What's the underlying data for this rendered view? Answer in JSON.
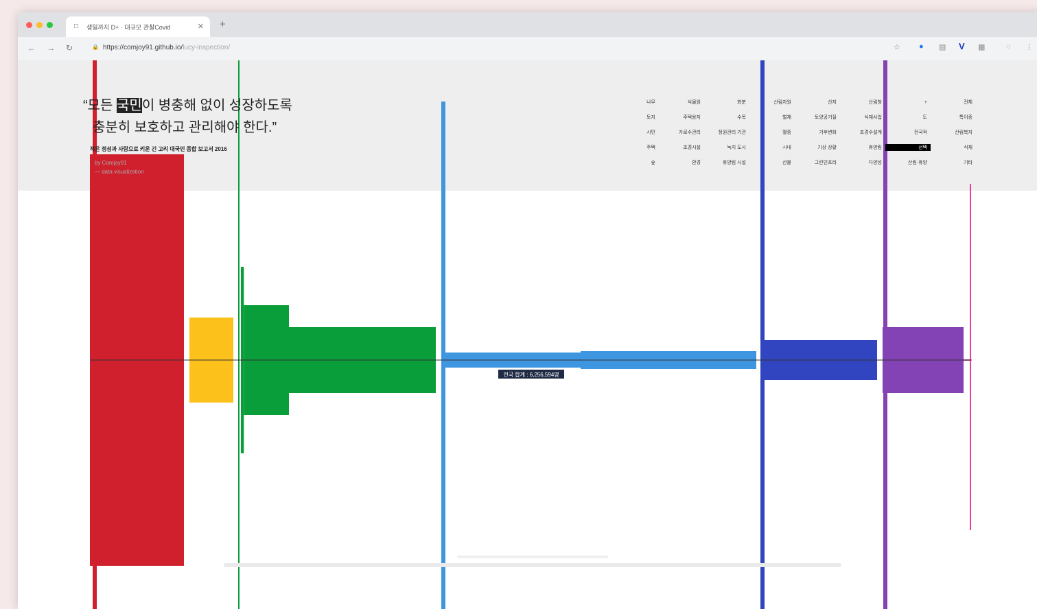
{
  "browser": {
    "tab_favicon": "□",
    "tab_title": "생일까지 D+ · 대규모 관찰Covid",
    "tab_close": "✕",
    "new_tab": "+",
    "back": "←",
    "forward": "→",
    "reload": "↻",
    "lock": "🔒",
    "url": "https://comjoy91.github.io/",
    "url_path": "lucy-inspection/",
    "ext_star": "☆",
    "ext_1": "●",
    "ext_2": "▤",
    "ext_3": "V",
    "ext_4": "▦",
    "ext_5": "◌",
    "ext_6": "⋮"
  },
  "quote": {
    "open_mark": "“",
    "line1_a": "모든 ",
    "line1_hl": "국민",
    "line1_b": "이 병충해 없이 성장하도록",
    "line2": "충분히 보호하고 관리해야 한다.",
    "close_mark": "”",
    "cite": "작은 정성과 사랑으로 키운 긴 고리 대국민 종합 보고서 2016",
    "sub1": "by Comjoy91",
    "sub2": "— data visualization"
  },
  "nav_grid": [
    [
      "나무",
      "식물원",
      "화분",
      "산림자원",
      "산지",
      "산림청",
      "+",
      "전체"
    ],
    [
      "토지",
      "주택용지",
      "수목",
      "벌채",
      "토양공기질",
      "식재사업",
      "도",
      "특이종"
    ],
    [
      "시민",
      "가로수관리",
      "정원관리 기관",
      "멸종",
      "기후변화",
      "조경수설계",
      "전국적",
      "산림복지"
    ],
    [
      "주택",
      "조경시설",
      "녹지 도시",
      "시내",
      "기상 상황",
      "휴양림",
      "선택",
      "식재"
    ],
    [
      "숲",
      "환경",
      "휴양림 시설",
      "산불",
      "그린인프라",
      "다양성",
      "산림·휴양",
      "기타"
    ]
  ],
  "nav_active": {
    "row": 3,
    "col": 6
  },
  "chart_data": {
    "type": "bar",
    "orientation": "horizontal-stream",
    "annotation": "전국 합계 : 6,256,594명",
    "colors": [
      "#d0202e",
      "#fcc21b",
      "#0a9e3a",
      "#3f96e0",
      "#3145c1",
      "#8443b5",
      "#e83d9f"
    ],
    "series": [
      {
        "color": "#d0202e",
        "segments": [
          {
            "x0": 0,
            "x1": 1,
            "half": 15
          }
        ]
      },
      {
        "color": "#fcc21b",
        "segments": [
          {
            "x0": 1,
            "x1": 2,
            "half": 3.1
          }
        ]
      },
      {
        "color": "#0a9e3a",
        "segments": [
          {
            "x0": 2,
            "x1": 2.1,
            "half": 6.8
          },
          {
            "x0": 2.1,
            "x1": 3,
            "half": 4
          },
          {
            "x0": 3,
            "x1": 6,
            "half": 2.4
          }
        ]
      },
      {
        "color": "#3f96e0",
        "segments": [
          {
            "x0": 6,
            "x1": 9,
            "half": 0.55
          },
          {
            "x0": 9,
            "x1": 12,
            "half": 0.65
          }
        ]
      },
      {
        "color": "#3145c1",
        "segments": [
          {
            "x0": 12,
            "x1": 14,
            "half": 1.45
          }
        ]
      },
      {
        "color": "#8443b5",
        "segments": [
          {
            "x0": 14,
            "x1": 15.5,
            "half": 2.4
          }
        ]
      },
      {
        "color": "#e83d9f",
        "segments": [
          {
            "x0": 15.5,
            "x1": 16,
            "half": 0.05
          }
        ]
      }
    ],
    "dividers": [
      {
        "x": 0,
        "color": "#d0202e",
        "thick": true
      },
      {
        "x": 2,
        "color": "#0a9e3a",
        "thick": false
      },
      {
        "x": 6,
        "color": "#3f96e0",
        "thick": true
      },
      {
        "x": 12,
        "color": "#3145c1",
        "thick": true
      },
      {
        "x": 15,
        "color": "#8443b5",
        "thick": true
      },
      {
        "x": 16,
        "color": "#e83d9f",
        "thick": false
      }
    ]
  }
}
